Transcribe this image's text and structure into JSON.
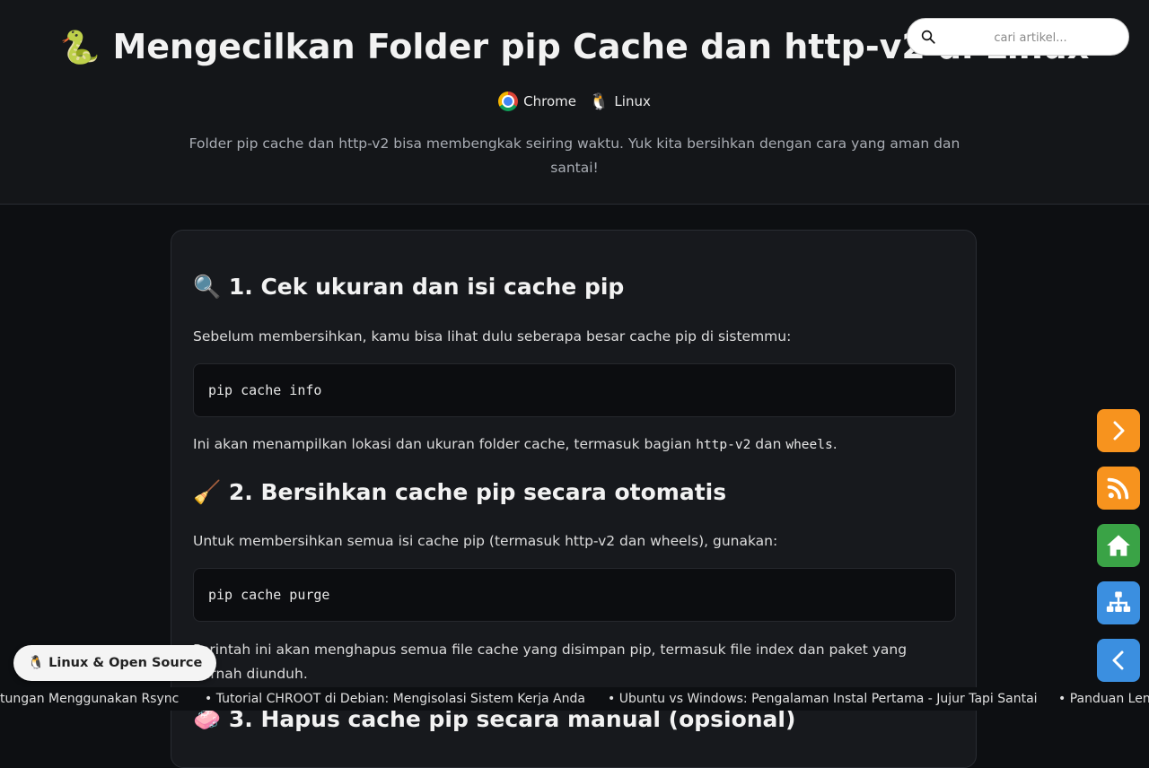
{
  "header": {
    "emoji": "🐍",
    "title": "Mengecilkan Folder pip Cache dan http-v2 di Linux",
    "platforms": [
      {
        "icon": "chrome-icon",
        "label": "Chrome"
      },
      {
        "icon": "tux-icon",
        "label": "Linux"
      }
    ],
    "subtitle": "Folder pip cache dan http-v2 bisa membengkak seiring waktu. Yuk kita bersihkan dengan cara yang aman dan santai!"
  },
  "search": {
    "placeholder": "cari artikel...",
    "value": ""
  },
  "article": {
    "section1": {
      "emoji": "🔍",
      "heading": "1. Cek ukuran dan isi cache pip",
      "intro": "Sebelum membersihkan, kamu bisa lihat dulu seberapa besar cache pip di sistemmu:",
      "code": "pip cache info",
      "after_prefix": "Ini akan menampilkan lokasi dan ukuran folder cache, termasuk bagian ",
      "after_code1": "http-v2",
      "after_mid": " dan ",
      "after_code2": "wheels",
      "after_suffix": "."
    },
    "section2": {
      "emoji": "🧹",
      "heading": "2. Bersihkan cache pip secara otomatis",
      "intro": "Untuk membersihkan semua isi cache pip (termasuk http-v2 dan wheels), gunakan:",
      "code": "pip cache purge",
      "after": "Perintah ini akan menghapus semua file cache yang disimpan pip, termasuk file index dan paket yang pernah diunduh."
    },
    "section3": {
      "emoji": "🧼",
      "heading": "3. Hapus cache pip secara manual (opsional)"
    }
  },
  "side_buttons": [
    {
      "name": "next-button",
      "icon": "chevron-right-icon",
      "color": "#f7931e"
    },
    {
      "name": "rss-button",
      "icon": "rss-icon",
      "color": "#f7931e"
    },
    {
      "name": "home-button",
      "icon": "home-icon",
      "color": "#3aa346"
    },
    {
      "name": "sitemap-button",
      "icon": "sitemap-icon",
      "color": "#3b8fe0"
    },
    {
      "name": "prev-button",
      "icon": "chevron-left-icon",
      "color": "#3b8fe0"
    }
  ],
  "badge": {
    "icon": "🐧",
    "label": "Linux & Open Source"
  },
  "ticker": [
    "tungan Menggunakan Rsync",
    "Tutorial CHROOT di Debian: Mengisolasi Sistem Kerja Anda",
    "Ubuntu vs Windows: Pengalaman Instal Pertama - Jujur Tapi Santai",
    "Panduan Len"
  ],
  "colors": {
    "background": "#0d0f12",
    "header": "#141619",
    "card": "#17191d",
    "orange": "#f7931e",
    "green": "#3aa346",
    "blue": "#3b8fe0"
  }
}
